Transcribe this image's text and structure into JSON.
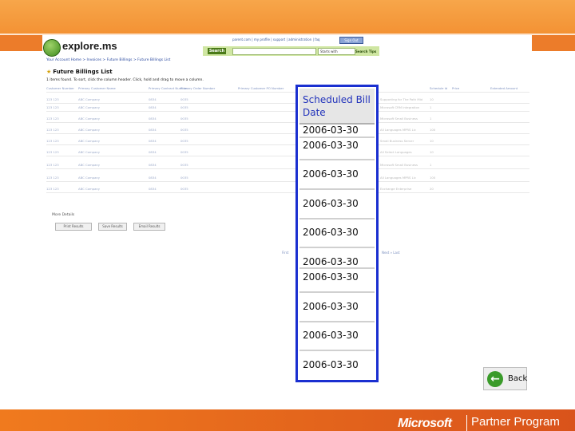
{
  "header": {
    "logo": "explore.ms",
    "nav": "parent.com | my profile | support | administration | faq",
    "signout": "Sign Out",
    "search_button": "Search",
    "search_scope": "Starts with",
    "search_tips": "Search Tips"
  },
  "breadcrumb": "Your Account Home > Invoices > Future Billings > Future Billings List",
  "page_title": "Future Billings List",
  "instructions": "1 items found. To sort, click the column header. Click, hold and drag to move a column.",
  "background_columns": [
    "Customer Number",
    "Primary Customer Name",
    "Primary Contract Number",
    "Primary Order Number",
    "Primary Customer PO Number",
    "Schedule Id",
    "Status",
    "Price",
    "Extended Amount"
  ],
  "background_rows": [
    {
      "num": "123 123",
      "name": "ABC Company",
      "contract": "0834",
      "order": "0035",
      "desc": "Supporting for The Path Mid",
      "qty": "10"
    },
    {
      "num": "123 123",
      "name": "ABC Company",
      "contract": "0834",
      "order": "0035",
      "desc": "Microsoft CRM Integration",
      "qty": "1"
    },
    {
      "num": "123 123",
      "name": "ABC Company",
      "contract": "0834",
      "order": "0035",
      "desc": "Microsoft Small Business",
      "qty": "1"
    },
    {
      "num": "123 123",
      "name": "ABC Company",
      "contract": "0834",
      "order": "0035",
      "desc": "All Languages MPRS Lic",
      "qty": "100"
    },
    {
      "num": "123 123",
      "name": "ABC Company",
      "contract": "0834",
      "order": "0035",
      "desc": "Small Business Server",
      "qty": "10"
    },
    {
      "num": "123 123",
      "name": "ABC Company",
      "contract": "0834",
      "order": "0035",
      "desc": "All Select Languages",
      "qty": "10"
    },
    {
      "num": "123 123",
      "name": "ABC Company",
      "contract": "0834",
      "order": "0035",
      "desc": "Microsoft Small Business",
      "qty": "1"
    },
    {
      "num": "123 123",
      "name": "ABC Company",
      "contract": "0834",
      "order": "0035",
      "desc": "All Languages MPRS Lic",
      "qty": "100"
    },
    {
      "num": "123 123",
      "name": "ABC Company",
      "contract": "0834",
      "order": "0035",
      "desc": "Exchange Enterprise",
      "qty": "20"
    }
  ],
  "more_details": "More Details",
  "actions": [
    "Print Results",
    "Save Results",
    "Email Results"
  ],
  "pager": {
    "first": "First",
    "next": "Next » Last"
  },
  "callout": {
    "header": "Scheduled Bill Date",
    "values": [
      "2006-03-30",
      "2006-03-30",
      "2006-03-30",
      "2006-03-30",
      "2006-03-30",
      "2006-03-30",
      "2006-03-30",
      "2006-03-30",
      "2006-03-30",
      "2006-03-30"
    ]
  },
  "back_button": "Back",
  "footer": {
    "brand": "Microsoft",
    "program": "Partner Program"
  },
  "colors": {
    "accent_orange": "#f39234",
    "callout_border": "#1a2fd0",
    "search_green": "#cfe6a2"
  }
}
